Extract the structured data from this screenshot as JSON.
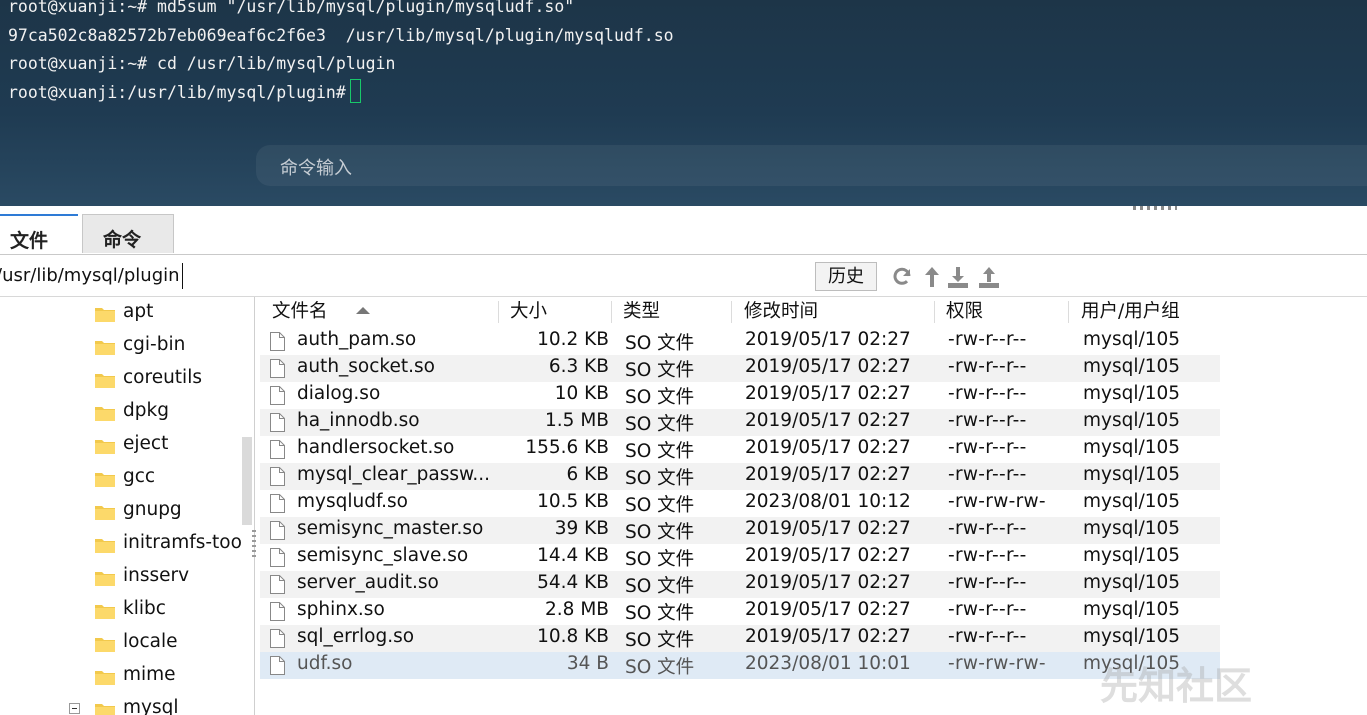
{
  "terminal": {
    "lines": [
      "root@xuanji:~# md5sum \"/usr/lib/mysql/plugin/mysqludf.so\"",
      "97ca502c8a82572b7eb069eaf6c2f6e3  /usr/lib/mysql/plugin/mysqludf.so",
      "root@xuanji:~# cd /usr/lib/mysql/plugin"
    ],
    "prompt": "root@xuanji:/usr/lib/mysql/plugin#",
    "command_placeholder": "命令输入",
    "cursor_color": "#18c86a"
  },
  "tabs": [
    {
      "label": "文件",
      "active": true
    },
    {
      "label": "命令",
      "active": false
    }
  ],
  "path": {
    "value": "/usr/lib/mysql/plugin",
    "history_label": "历史"
  },
  "toolbar_icons": [
    "refresh-icon",
    "up-directory-icon",
    "download-icon",
    "upload-icon"
  ],
  "tree": {
    "items": [
      {
        "label": "apt"
      },
      {
        "label": "cgi-bin"
      },
      {
        "label": "coreutils"
      },
      {
        "label": "dpkg"
      },
      {
        "label": "eject"
      },
      {
        "label": "gcc"
      },
      {
        "label": "gnupg"
      },
      {
        "label": "initramfs-too"
      },
      {
        "label": "insserv"
      },
      {
        "label": "klibc"
      },
      {
        "label": "locale"
      },
      {
        "label": "mime"
      },
      {
        "label": "mysql",
        "expanded": true
      }
    ]
  },
  "file_table": {
    "columns": {
      "name": "文件名",
      "size": "大小",
      "type": "类型",
      "modified": "修改时间",
      "permissions": "权限",
      "owner": "用户/用户组"
    },
    "rows": [
      {
        "name": "auth_pam.so",
        "size": "10.2 KB",
        "type": "SO 文件",
        "modified": "2019/05/17 02:27",
        "permissions": "-rw-r--r--",
        "owner": "mysql/105"
      },
      {
        "name": "auth_socket.so",
        "size": "6.3 KB",
        "type": "SO 文件",
        "modified": "2019/05/17 02:27",
        "permissions": "-rw-r--r--",
        "owner": "mysql/105"
      },
      {
        "name": "dialog.so",
        "size": "10 KB",
        "type": "SO 文件",
        "modified": "2019/05/17 02:27",
        "permissions": "-rw-r--r--",
        "owner": "mysql/105"
      },
      {
        "name": "ha_innodb.so",
        "size": "1.5 MB",
        "type": "SO 文件",
        "modified": "2019/05/17 02:27",
        "permissions": "-rw-r--r--",
        "owner": "mysql/105"
      },
      {
        "name": "handlersocket.so",
        "size": "155.6 KB",
        "type": "SO 文件",
        "modified": "2019/05/17 02:27",
        "permissions": "-rw-r--r--",
        "owner": "mysql/105"
      },
      {
        "name": "mysql_clear_passw...",
        "size": "6 KB",
        "type": "SO 文件",
        "modified": "2019/05/17 02:27",
        "permissions": "-rw-r--r--",
        "owner": "mysql/105"
      },
      {
        "name": "mysqludf.so",
        "size": "10.5 KB",
        "type": "SO 文件",
        "modified": "2023/08/01 10:12",
        "permissions": "-rw-rw-rw-",
        "owner": "mysql/105"
      },
      {
        "name": "semisync_master.so",
        "size": "39 KB",
        "type": "SO 文件",
        "modified": "2019/05/17 02:27",
        "permissions": "-rw-r--r--",
        "owner": "mysql/105"
      },
      {
        "name": "semisync_slave.so",
        "size": "14.4 KB",
        "type": "SO 文件",
        "modified": "2019/05/17 02:27",
        "permissions": "-rw-r--r--",
        "owner": "mysql/105"
      },
      {
        "name": "server_audit.so",
        "size": "54.4 KB",
        "type": "SO 文件",
        "modified": "2019/05/17 02:27",
        "permissions": "-rw-r--r--",
        "owner": "mysql/105"
      },
      {
        "name": "sphinx.so",
        "size": "2.8 MB",
        "type": "SO 文件",
        "modified": "2019/05/17 02:27",
        "permissions": "-rw-r--r--",
        "owner": "mysql/105"
      },
      {
        "name": "sql_errlog.so",
        "size": "10.8 KB",
        "type": "SO 文件",
        "modified": "2019/05/17 02:27",
        "permissions": "-rw-r--r--",
        "owner": "mysql/105"
      },
      {
        "name": "udf.so",
        "size": "34 B",
        "type": "SO 文件",
        "modified": "2023/08/01 10:01",
        "permissions": "-rw-rw-rw-",
        "owner": "mysql/105",
        "selected": true
      }
    ]
  },
  "watermark": "先知社区"
}
